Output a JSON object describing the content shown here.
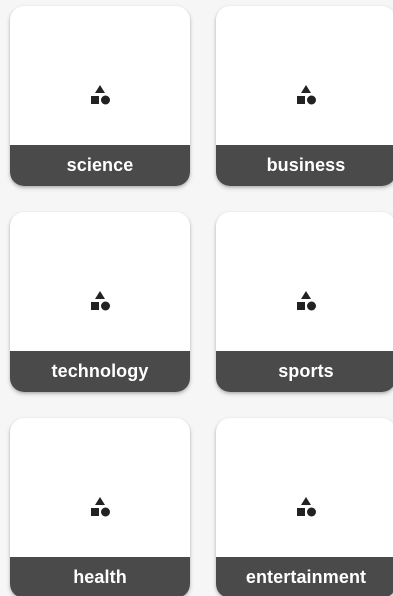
{
  "categories": [
    {
      "label": "science",
      "icon": "category-shapes-icon"
    },
    {
      "label": "business",
      "icon": "category-shapes-icon"
    },
    {
      "label": "technology",
      "icon": "category-shapes-icon"
    },
    {
      "label": "sports",
      "icon": "category-shapes-icon"
    },
    {
      "label": "health",
      "icon": "category-shapes-icon"
    },
    {
      "label": "entertainment",
      "icon": "category-shapes-icon"
    }
  ],
  "colors": {
    "background": "#f6f6f6",
    "card": "#ffffff",
    "label_bar": "#4a4a4a",
    "label_text": "#ffffff",
    "icon": "#222222"
  }
}
